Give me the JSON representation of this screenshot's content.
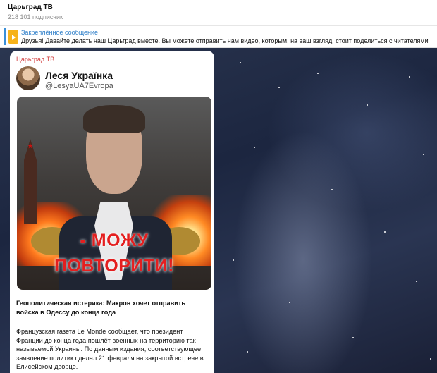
{
  "header": {
    "title": "Царьград ТВ",
    "subscribers": "218 101 подписчик"
  },
  "pinned": {
    "label": "Закреплённое сообщение",
    "text": "Друзья! Давайте делать наш Царьград вместе.  Вы можете отправить нам видео, которым, на ваш взгляд, стоит поделиться с читателями"
  },
  "post": {
    "channel": "Царьград ТВ",
    "author": "Леся Українка",
    "handle": "@LesyaUA7Evropa",
    "image_text_line1": "- МОЖУ",
    "image_text_line2": "ПОВТОРИТИ!",
    "headline": "Геополитическая истерика: Макрон хочет отправить войска в Одессу до конца года",
    "body": "Французская газета Le Monde сообщает, что президент Франции до конца года пошлёт военных на территорию так называемой Украины. По данным издания, соответствующее заявление политик сделал 21 февраля на закрытой встрече в Елисейском дворце."
  },
  "colors": {
    "accent_link": "#2f7fc9",
    "channel_red": "#d23c3c",
    "overlay_red": "#e41f1f"
  }
}
